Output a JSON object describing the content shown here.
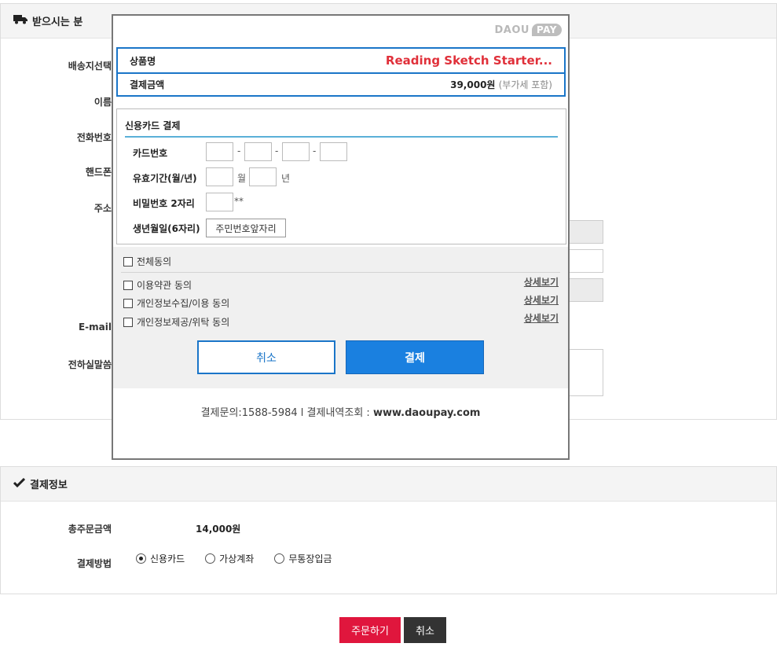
{
  "recipient_section": {
    "title": "받으시는 분",
    "labels": [
      "배송지선택",
      "이름",
      "전화번호",
      "핸드폰",
      "주소",
      "E-mail",
      "전하실말씀"
    ]
  },
  "payment_section": {
    "title": "결제정보",
    "total_label": "총주문금액",
    "total_value": "14,000원",
    "method_label": "결제방법",
    "methods": [
      "신용카드",
      "가상계좌",
      "무통장입금"
    ],
    "selected_method": "신용카드"
  },
  "page_buttons": {
    "order": "주문하기",
    "cancel": "취소"
  },
  "popup": {
    "logo_left": "DAOU",
    "logo_right": "PAY",
    "product_label": "상품명",
    "product_value": "Reading Sketch Starter...",
    "amount_label": "결제금액",
    "amount_value": "39,000원",
    "amount_note": "(부가세 포함)",
    "card": {
      "title": "신용카드 결제",
      "card_number_label": "카드번호",
      "expiry_label": "유효기간(월/년)",
      "expiry_month_unit": "월",
      "expiry_year_unit": "년",
      "password_label": "비밀번호 2자리",
      "password_suffix": "**",
      "birth_label": "생년월일(6자리)",
      "birth_button": "주민번호앞자리"
    },
    "agree_all": "전체동의",
    "agreements": [
      "이용약관 동의",
      "개인정보수집/이용 동의",
      "개인정보제공/위탁 동의"
    ],
    "detail_link": "상세보기",
    "cancel_button": "취소",
    "pay_button": "결제",
    "footer_text": "결제문의:1588-5984 l 결제내역조회 : ",
    "footer_site": "www.daoupay.com"
  },
  "colors": {
    "accent_blue": "#1a75c8",
    "order_red": "#e0163d",
    "product_red": "#e0303a"
  }
}
